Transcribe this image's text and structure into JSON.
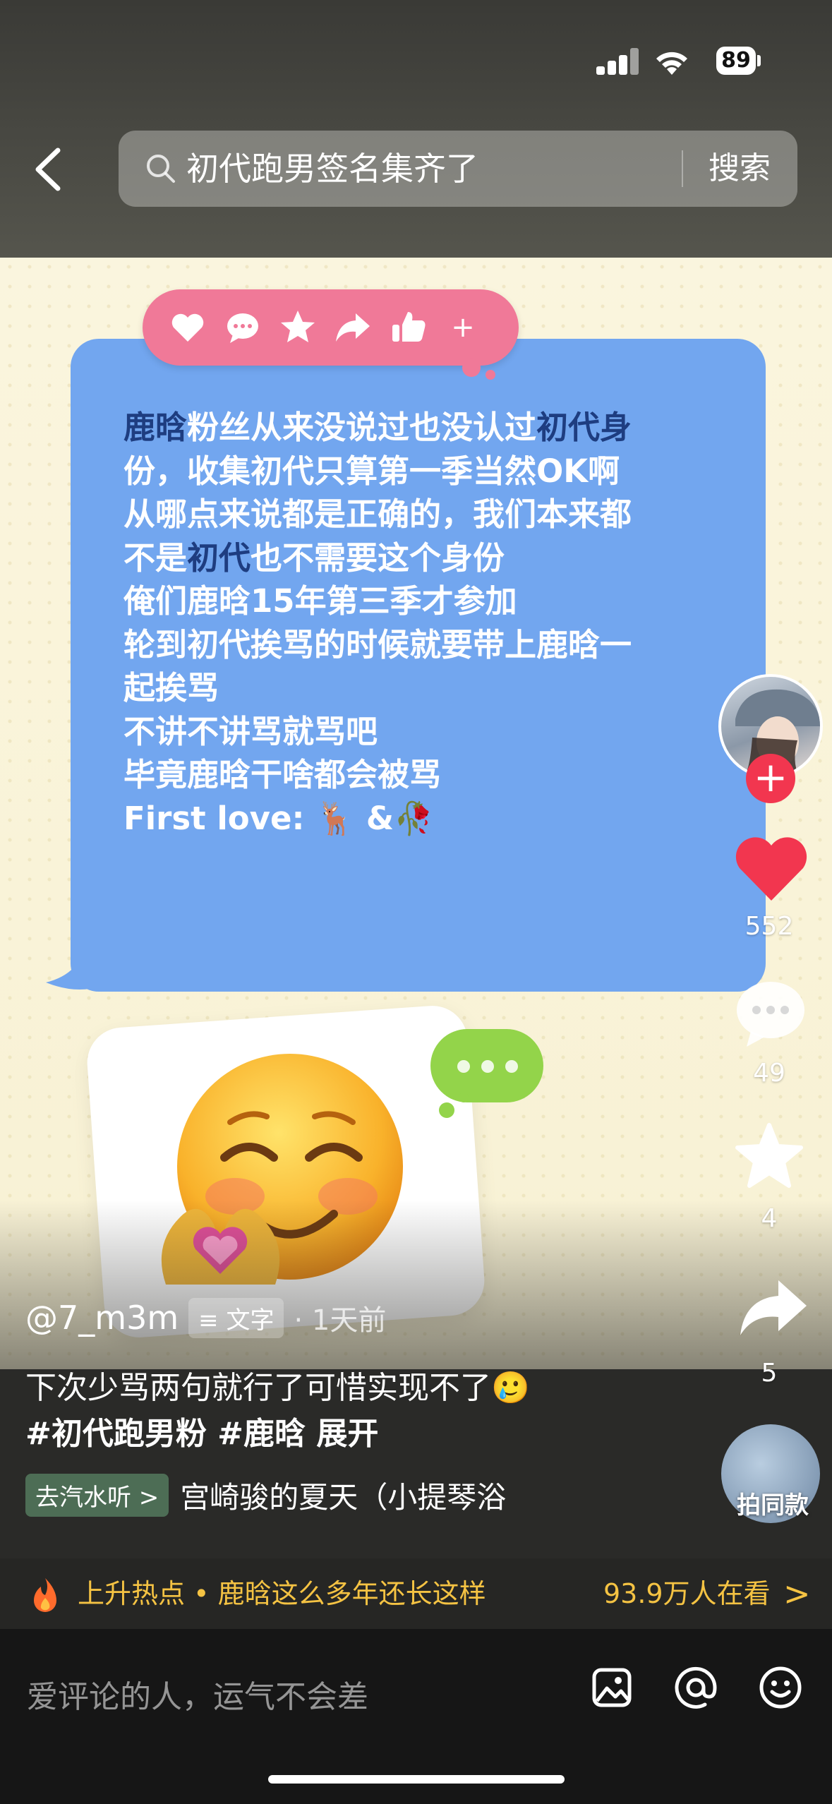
{
  "status_bar": {
    "battery": "89"
  },
  "search": {
    "query": "初代跑男签名集齐了",
    "button": "搜索"
  },
  "post_text_lines": [
    [
      "鹿晗",
      "粉丝从来没说过也没认过",
      "初代身"
    ],
    [
      "份，收集初代只算第一季当然OK啊"
    ],
    [
      "从哪点来说都是正确的，我们本来都"
    ],
    [
      "不是",
      "初代",
      "也不需要这个身份"
    ],
    [
      "俺们鹿晗15年第三季才参加"
    ],
    [
      "轮到初代挨骂的时候就要带上鹿晗一"
    ],
    [
      "起挨骂"
    ],
    [
      "不讲不讲骂就骂吧"
    ],
    [
      "毕竟鹿晗干啥都会被骂"
    ],
    [
      "First love: 🦌 & 🥀"
    ]
  ],
  "bubble": {
    "line1_a": "鹿晗",
    "line1_b": "粉丝从来没说过也没认过",
    "line1_c": "初代身",
    "line2": "份，收集初代只算第一季当然OK啊",
    "line3": "从哪点来说都是正确的，我们本来都",
    "line4_a": "不是",
    "line4_b": "初代",
    "line4_c": "也不需要这个身份",
    "line5": "俺们鹿晗15年第三季才参加",
    "line6": "轮到初代挨骂的时候就要带上鹿晗一",
    "line7": "起挨骂",
    "line8": "不讲不讲骂就骂吧",
    "line9": "毕竟鹿晗干啥都会被骂",
    "line10": "First love: 🦌 &🥀"
  },
  "reactions": [
    "heart-icon",
    "comment-icon",
    "star-icon",
    "share-icon",
    "thumbs-up-icon",
    "plus-icon"
  ],
  "emoji": "☺️",
  "heart_hands": "🫶",
  "rail": {
    "likes": "552",
    "comments": "49",
    "favorites": "4",
    "shares": "5",
    "shoot_same": "拍同款"
  },
  "author": {
    "handle": "@7_m3m",
    "type_tag": "文字",
    "time": "· 1天前"
  },
  "caption": {
    "line1": "下次少骂两句就行了可惜实现不了🥲",
    "tags": "#初代跑男粉 #鹿晗  展开"
  },
  "music": {
    "tag": "去汽水听 >",
    "name": "宫崎骏的夏天（小提琴浴"
  },
  "hot": {
    "text": "上升热点 • 鹿晗这么多年还长这样",
    "count": "93.9万人在看",
    "chevron": ">"
  },
  "comment": {
    "placeholder": "爱评论的人，运气不会差"
  },
  "colors": {
    "bubble": "#72a6ef",
    "like": "#f2364f",
    "hot": "#f5c343",
    "react_bar": "#f07998"
  }
}
